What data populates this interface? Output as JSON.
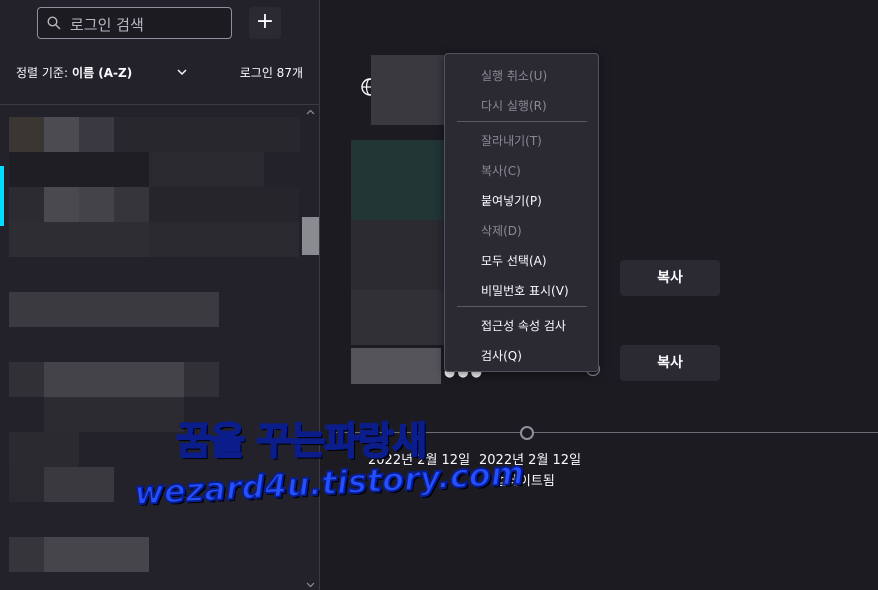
{
  "sidebar": {
    "search": {
      "placeholder": "로그인 검색",
      "icon": "search-icon"
    },
    "add_button": {
      "label": "+"
    },
    "sort": {
      "label": "정렬 기준:",
      "value": "이름 (A-Z)",
      "icon": "chevron-down-icon"
    },
    "login_count": "로그인 87개",
    "accent_color": "#00ddff"
  },
  "main": {
    "copy_buttons": [
      "복사",
      "복사"
    ],
    "password_dots": "●●●",
    "timeline": {
      "created_date": "2022년 2월 12일",
      "updated_date": "2022년 2월 12일",
      "updated_label": "업데이트됨"
    }
  },
  "context_menu": {
    "items": [
      {
        "label": "실행 취소(U)",
        "enabled": false
      },
      {
        "label": "다시 실행(R)",
        "enabled": false
      },
      {
        "label": "잘라내기(T)",
        "enabled": false
      },
      {
        "label": "복사(C)",
        "enabled": false
      },
      {
        "label": "붙여넣기(P)",
        "enabled": true
      },
      {
        "label": "삭제(D)",
        "enabled": false
      },
      {
        "label": "모두 선택(A)",
        "enabled": true
      },
      {
        "label": "비밀번호 표시(V)",
        "enabled": true
      },
      {
        "label": "접근성 속성 검사",
        "enabled": true
      },
      {
        "label": "검사(Q)",
        "enabled": true
      }
    ]
  },
  "watermark": {
    "title": "꿈을 꾸는파랑새",
    "url": "wezard4u.tistory.com"
  }
}
